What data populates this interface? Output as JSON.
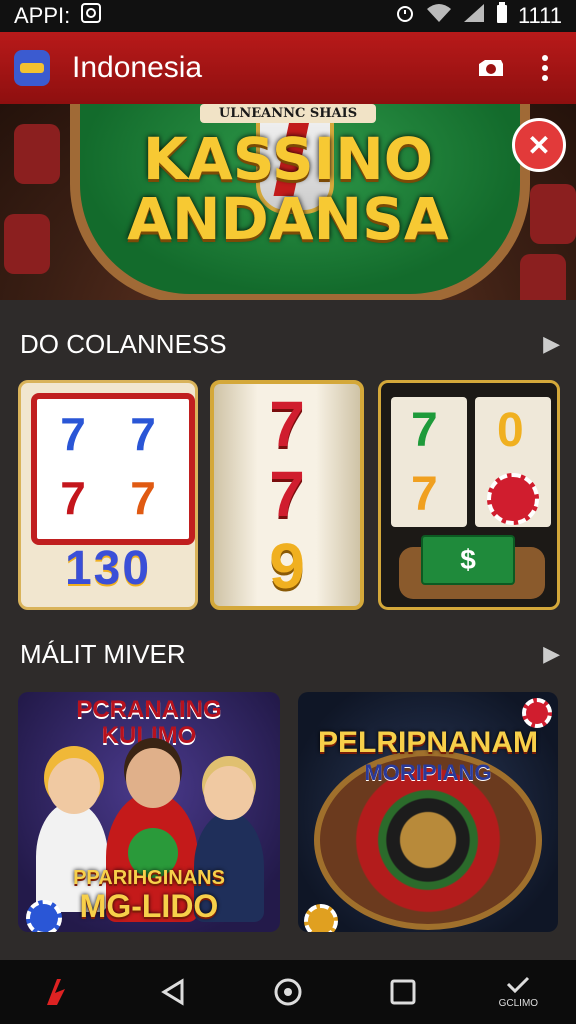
{
  "status_bar": {
    "carrier": "APPI:",
    "time": "1111"
  },
  "app_bar": {
    "title": "Indonesia"
  },
  "hero": {
    "badge_text": "ULNEANNC SHAIS",
    "title_line1": "KASSINO",
    "title_line2": "ANDANSA",
    "close_glyph": "✕"
  },
  "sections": {
    "slots": {
      "title": "DO COLANNESS",
      "arrow": "▶"
    },
    "promos": {
      "title": "MÁLIT MIVER",
      "arrow": "▶"
    }
  },
  "slot_tiles": {
    "tile1": {
      "reels": [
        "7",
        "7",
        "7",
        "7"
      ],
      "number": "130"
    },
    "tile2": {
      "reels": [
        "7",
        "7",
        "9"
      ]
    },
    "tile3": {
      "reels": [
        "7",
        "0",
        "7"
      ],
      "bill": "$"
    }
  },
  "promo_tiles": {
    "promo1": {
      "top_line1": "PCRANAING",
      "top_line2": "KULIMO",
      "bottom_line1": "PPARIHGINANS",
      "bottom_line2": "MG-LIDO"
    },
    "promo2": {
      "line1": "PELRIPNANAM",
      "line2": "MORIPIANG"
    }
  },
  "nav_bar": {
    "right_label": "GCLIMO"
  },
  "colors": {
    "appbar": "#b81a1a",
    "gold": "#f7c933",
    "background": "#2e2b2a"
  }
}
